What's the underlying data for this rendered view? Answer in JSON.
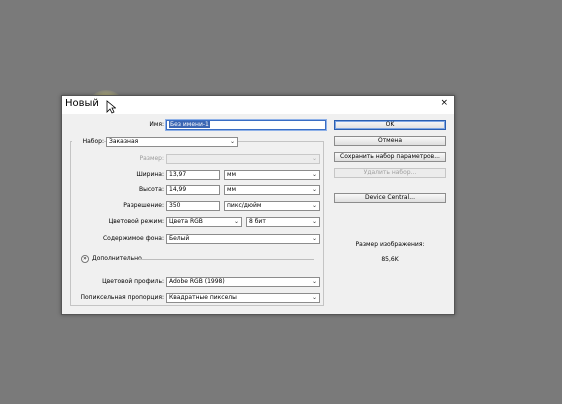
{
  "dialog": {
    "title": "Новый",
    "close_glyph": "×"
  },
  "form": {
    "name_label": "Имя:",
    "name_value": "Без имени-1",
    "preset_label": "Набор:",
    "preset_value": "Заказная",
    "size_label": "Размер:",
    "size_value": "",
    "width_label": "Ширина:",
    "width_value": "13,97",
    "width_unit": "мм",
    "height_label": "Высота:",
    "height_value": "14,99",
    "height_unit": "мм",
    "resolution_label": "Разрешение:",
    "resolution_value": "350",
    "resolution_unit": "пикс/дюйм",
    "color_mode_label": "Цветовой режим:",
    "color_mode_value": "Цвета RGB",
    "bit_depth_value": "8 бит",
    "background_label": "Содержимое фона:",
    "background_value": "Белый",
    "advanced_label": "Дополнительно",
    "advanced_toggle": "»",
    "color_profile_label": "Цветовой профиль:",
    "color_profile_value": "Adobe RGB (1998)",
    "pixel_aspect_label": "Попиксельная пропорция:",
    "pixel_aspect_value": "Квадратные пикселы"
  },
  "buttons": {
    "ok": "OK",
    "cancel": "Отмена",
    "save_preset": "Сохранить набор параметров...",
    "delete_preset": "Удалить набор...",
    "device_central": "Device Central..."
  },
  "info": {
    "image_size_label": "Размер изображения:",
    "image_size_value": "85,6K"
  },
  "icons": {
    "dropdown": "chevron-down-icon"
  }
}
